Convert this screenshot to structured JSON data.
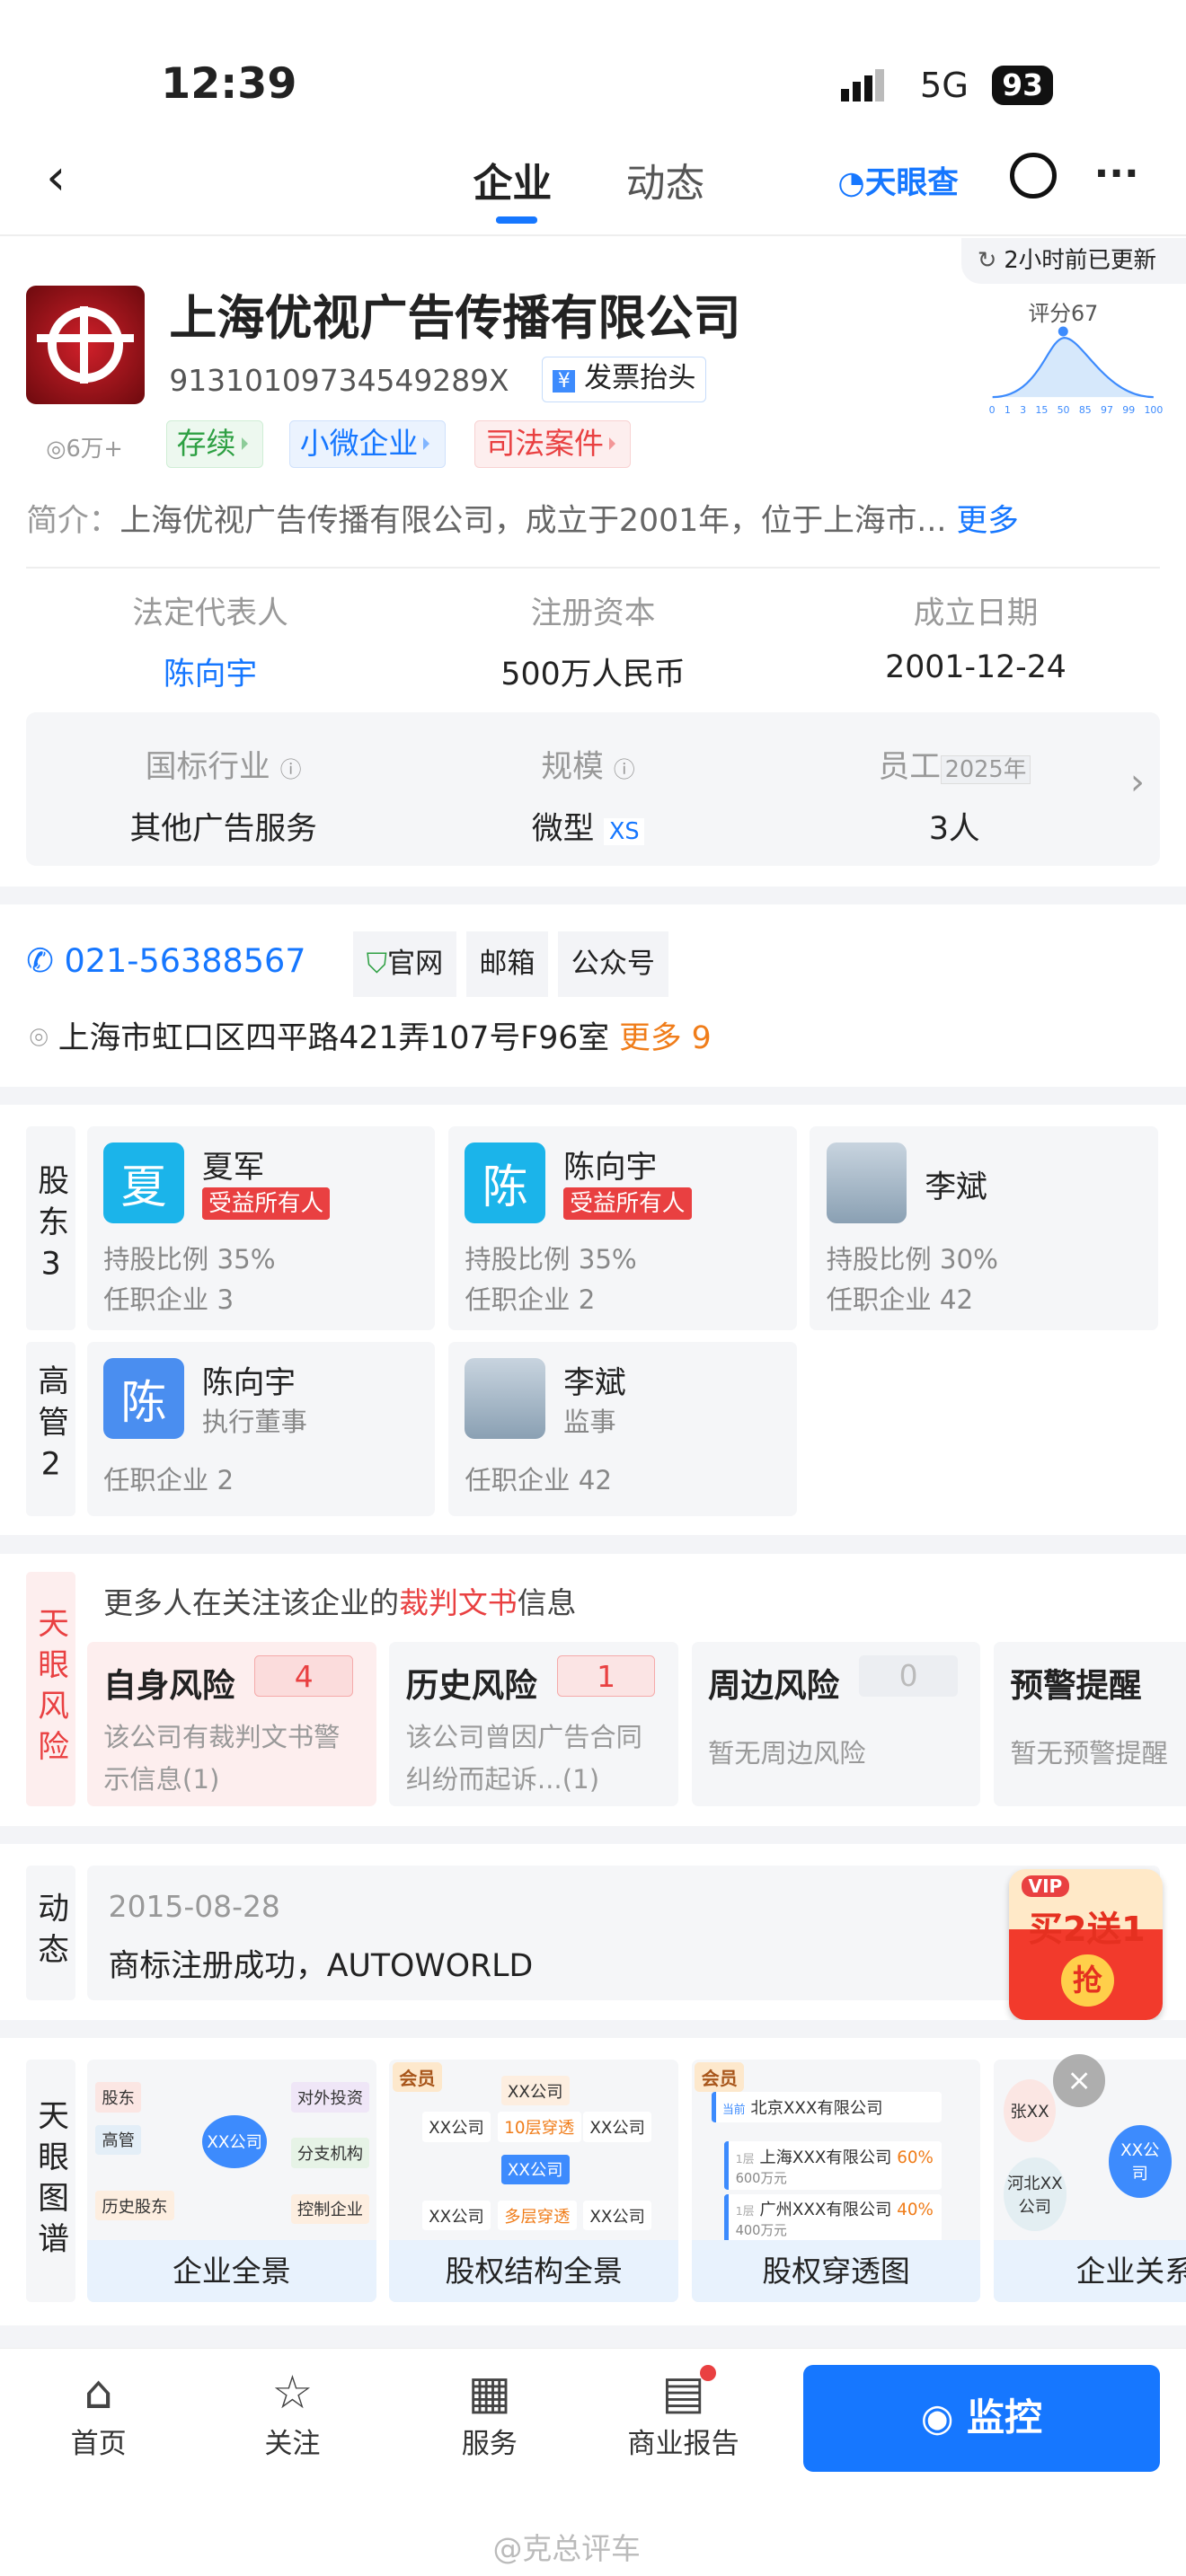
{
  "status": {
    "time": "12:39",
    "network": "5G",
    "battery": "93"
  },
  "nav": {
    "tabs": [
      "企业",
      "动态"
    ],
    "brand": "天眼查"
  },
  "company": {
    "update": "2小时前已更新",
    "name": "上海优视广告传播有限公司",
    "credit_code": "91310109734549289X",
    "invoice_label": "发票抬头",
    "score_label": "评分67",
    "score_ticks": [
      "0",
      "1",
      "3",
      "15",
      "50",
      "85",
      "97",
      "99",
      "100"
    ],
    "views": "6万+",
    "tags": [
      "存续",
      "小微企业",
      "司法案件"
    ],
    "intro_label": "简介：",
    "intro": "上海优视广告传播有限公司，成立于2001年，位于上海市...",
    "more": "更多",
    "key_info": [
      {
        "label": "法定代表人",
        "value": "陈向宇"
      },
      {
        "label": "注册资本",
        "value": "500万人民币"
      },
      {
        "label": "成立日期",
        "value": "2001-12-24"
      }
    ],
    "industry": {
      "label": "国标行业",
      "value": "其他广告服务"
    },
    "scale": {
      "label": "规模",
      "value": "微型",
      "badge": "XS"
    },
    "staff": {
      "label": "员工",
      "year": "2025年",
      "value": "3人"
    }
  },
  "contact": {
    "phone": "021-56388567",
    "links": [
      "官网",
      "邮箱",
      "公众号"
    ],
    "address": "上海市虹口区四平路421弄107号F96室",
    "more": "更多 9"
  },
  "shareholders": {
    "side": "股东3",
    "items": [
      {
        "avatar": "夏",
        "name": "夏军",
        "badge": "受益所有人",
        "ratio": "持股比例 35%",
        "jobs": "任职企业 3"
      },
      {
        "avatar": "陈",
        "name": "陈向宇",
        "badge": "受益所有人",
        "ratio": "持股比例 35%",
        "jobs": "任职企业 2"
      },
      {
        "name": "李斌",
        "ratio": "持股比例 30%",
        "jobs": "任职企业 42"
      }
    ]
  },
  "executives": {
    "side": "高管2",
    "items": [
      {
        "avatar": "陈",
        "name": "陈向宇",
        "role": "执行董事",
        "jobs": "任职企业 2"
      },
      {
        "name": "李斌",
        "role": "监事",
        "jobs": "任职企业 42"
      }
    ]
  },
  "risk": {
    "side": "天眼风险",
    "headline_a": "更多人在关注该企业的",
    "headline_b": "裁判文书",
    "headline_c": "信息",
    "cards": [
      {
        "title": "自身风险",
        "count": "4",
        "desc": "该公司有裁判文书警示信息(1)"
      },
      {
        "title": "历史风险",
        "count": "1",
        "desc": "该公司曾因广告合同纠纷而起诉...(1)"
      },
      {
        "title": "周边风险",
        "count": "0",
        "desc": "暂无周边风险"
      },
      {
        "title": "预警提醒",
        "count": "",
        "desc": "暂无预警提醒"
      }
    ]
  },
  "news": {
    "side": "动态",
    "date": "2015-08-28",
    "text": "商标注册成功，AUTOWORLD",
    "promo": {
      "vip": "VIP",
      "text": "买2送1",
      "grab": "抢"
    }
  },
  "graph": {
    "side": "天眼图谱",
    "member": "会员",
    "cards": [
      {
        "caption": "企业全景",
        "nodes": [
          "股东",
          "高管",
          "历史股东",
          "XX公司",
          "对外投资",
          "分支机构",
          "控制企业"
        ]
      },
      {
        "caption": "股权结构全景",
        "nodes": [
          "XX公司",
          "XX公司",
          "10层穿透",
          "XX公司",
          "XX公司",
          "XX公司",
          "多层穿透",
          "XX公司"
        ]
      },
      {
        "caption": "股权穿透图",
        "rows": [
          {
            "tag": "当前",
            "name": "北京XXX有限公司"
          },
          {
            "tag": "1层",
            "name": "上海XXX有限公司",
            "pct": "60%",
            "amt": "600万元"
          },
          {
            "tag": "1层",
            "name": "广州XXX有限公司",
            "pct": "40%",
            "amt": "400万元"
          }
        ]
      },
      {
        "caption": "企业关系",
        "nodes": [
          "张XX",
          "XX公司",
          "河北XX公司"
        ]
      }
    ]
  },
  "tabbar": {
    "items": [
      "首页",
      "关注",
      "服务",
      "商业报告"
    ],
    "monitor": "监控"
  },
  "watermark": "@克总评车",
  "colors": {
    "accent": "#1677ff",
    "danger": "#e94041",
    "monitor": "#1677ff"
  }
}
